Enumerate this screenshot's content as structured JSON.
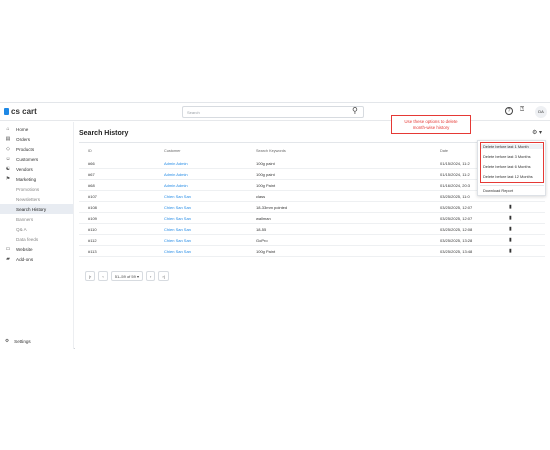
{
  "topbar": {
    "logo": "cs cart",
    "search_placeholder": "Search",
    "avatar": "DA"
  },
  "sidebar": {
    "items": [
      {
        "label": "Home",
        "icon": "home-icon"
      },
      {
        "label": "Orders",
        "icon": "orders-icon"
      },
      {
        "label": "Products",
        "icon": "products-icon"
      },
      {
        "label": "Customers",
        "icon": "customers-icon"
      },
      {
        "label": "Vendors",
        "icon": "vendors-icon"
      },
      {
        "label": "Marketing",
        "icon": "marketing-icon"
      },
      {
        "label": "Promotions"
      },
      {
        "label": "Newsletters"
      },
      {
        "label": "Search History"
      },
      {
        "label": "Banners"
      },
      {
        "label": "Q& A"
      },
      {
        "label": "Data feeds"
      },
      {
        "label": "Website",
        "icon": "website-icon"
      },
      {
        "label": "Add-ons",
        "icon": "addons-icon"
      }
    ],
    "settings": "Settings"
  },
  "main": {
    "title": "Search History",
    "columns": {
      "id": "ID",
      "customer": "Customer",
      "keywords": "Search Keywords",
      "date": "Date"
    },
    "rows": [
      {
        "id": "#66",
        "customer": "Admin Admin",
        "keywords": "100g paint",
        "date": "01/15/2024, 11:2"
      },
      {
        "id": "#67",
        "customer": "Admin Admin",
        "keywords": "100g paint",
        "date": "01/15/2024, 11:2"
      },
      {
        "id": "#68",
        "customer": "Admin Admin",
        "keywords": "100g Paint",
        "date": "01/16/2024, 20:3"
      },
      {
        "id": "#107",
        "customer": "Chien San San",
        "keywords": "class",
        "date": "03/25/2025, 11:0"
      },
      {
        "id": "#108",
        "customer": "Chien San San",
        "keywords": "18-33mm pointed",
        "date": "03/25/2025, 12:07"
      },
      {
        "id": "#109",
        "customer": "Chien San San",
        "keywords": "wallman",
        "date": "03/25/2025, 12:07"
      },
      {
        "id": "#110",
        "customer": "Chien San San",
        "keywords": "18-55",
        "date": "03/25/2025, 12:08"
      },
      {
        "id": "#112",
        "customer": "Chien San San",
        "keywords": "GoPro",
        "date": "03/25/2025, 13:28"
      },
      {
        "id": "#113",
        "customer": "Chien San San",
        "keywords": "100g Paint",
        "date": "03/25/2025, 13:48"
      }
    ],
    "pager": {
      "first": "|‹",
      "prev": "‹",
      "range": "51–59 of 59 ▾",
      "next": "›",
      "last": "›|"
    }
  },
  "dropdown": {
    "items": [
      "Delete before last 1 Month",
      "Delete before last 3 Months",
      "Delete before last 6 Months",
      "Delete before last 12 Months"
    ],
    "download": "Download Report"
  },
  "callout": {
    "line1": "Use these options to delete",
    "line2": "month-wise history"
  },
  "colors": {
    "accent": "#1e88e5",
    "callout": "#e53935"
  }
}
